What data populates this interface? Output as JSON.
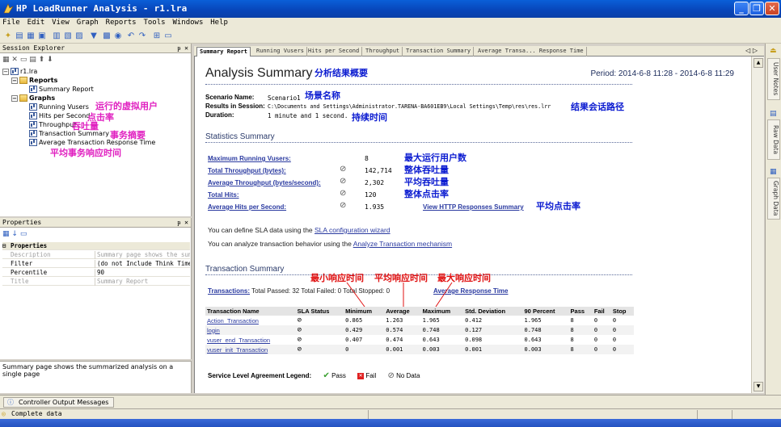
{
  "window": {
    "title": "HP LoadRunner Analysis - r1.lra"
  },
  "menu": [
    "File",
    "Edit",
    "View",
    "Graph",
    "Reports",
    "Tools",
    "Windows",
    "Help"
  ],
  "explorer": {
    "header": "Session Explorer",
    "root": "r1.lra",
    "reports": "Reports",
    "summary_report": "Summary Report",
    "graphs": "Graphs",
    "graph_items": [
      "Running Vusers",
      "Hits per Second",
      "Throughput",
      "Transaction Summary",
      "Average Transaction Response Time"
    ]
  },
  "annotations": {
    "running_vusers": "运行的虚拟用户",
    "hits_per_second": "点击率",
    "throughput": "吞吐量",
    "transaction_summary": "事务摘要",
    "avg_response": "平均事务响应时间",
    "analysis_summary": "分析结果概要",
    "scenario_name": "场景名称",
    "session_path": "结果会话路径",
    "duration": "持续时间",
    "max_running": "最大运行用户数",
    "total_throughput": "整体吞吐量",
    "avg_throughput": "平均吞吐量",
    "total_hits": "整体点击率",
    "avg_hits": "平均点击率",
    "min_resp": "最小响应时间",
    "avg_resp": "平均响应时间",
    "max_resp": "最大响应时间"
  },
  "properties": {
    "header": "Properties",
    "section": "Properties",
    "rows": [
      {
        "key": "Description",
        "value": "Summary page shows the summa"
      },
      {
        "key": "Filter",
        "value": "(do not Include Think Time)"
      },
      {
        "key": "Percentile",
        "value": "90"
      },
      {
        "key": "Title",
        "value": "Summary Report"
      }
    ],
    "description": "Summary page shows the summarized analysis on a single page"
  },
  "tabs": [
    "Summary Report",
    "Running Vusers",
    "Hits per Second",
    "Throughput",
    "Transaction Summary",
    "Average Transa... Response Time"
  ],
  "report": {
    "title": "Analysis Summary",
    "period": "Period: 2014-6-8 11:28 - 2014-6-8 11:29",
    "scenario_label": "Scenario Name:",
    "scenario_value": "Scenario1",
    "session_label": "Results in Session:",
    "session_value": "C:\\Documents and Settings\\Administrator.TARENA-BA601EB9\\Local Settings\\Temp\\res\\res.lrr",
    "duration_label": "Duration:",
    "duration_value": "1 minute and 1 second.",
    "stats_title": "Statistics Summary",
    "stats": [
      {
        "label": "Maximum Running Vusers:",
        "value": "8",
        "icon": false
      },
      {
        "label": "Total Throughput (bytes):",
        "value": "142,714",
        "icon": true
      },
      {
        "label": "Average Throughput (bytes/second):",
        "value": "2,302",
        "icon": true
      },
      {
        "label": "Total Hits:",
        "value": "120",
        "icon": true
      },
      {
        "label": "Average Hits per Second:",
        "value": "1.935",
        "icon": true
      }
    ],
    "http_link": "View HTTP Responses Summary",
    "sla_line_pre": "You can define SLA data using the ",
    "sla_link": "SLA configuration wizard",
    "analyze_line_pre": "You can analyze transaction behavior using the ",
    "analyze_link": "Analyze Transaction mechanism",
    "trans_title": "Transaction Summary",
    "trans_link": "Transactions:",
    "trans_counts": "Total Passed: 32 Total Failed: 0 Total Stopped: 0",
    "avg_resp_link": "Average Response Time",
    "columns": [
      "Transaction Name",
      "SLA Status",
      "Minimum",
      "Average",
      "Maximum",
      "Std. Deviation",
      "90 Percent",
      "Pass",
      "Fail",
      "Stop"
    ],
    "rows": [
      [
        "Action_Transaction",
        "",
        "0.865",
        "1.263",
        "1.965",
        "0.412",
        "1.965",
        "8",
        "0",
        "0"
      ],
      [
        "login",
        "",
        "0.429",
        "0.574",
        "0.748",
        "0.127",
        "0.748",
        "8",
        "0",
        "0"
      ],
      [
        "vuser_end_Transaction",
        "",
        "0.407",
        "0.474",
        "0.643",
        "0.098",
        "0.643",
        "8",
        "0",
        "0"
      ],
      [
        "vuser_init_Transaction",
        "",
        "0",
        "0.001",
        "0.003",
        "0.001",
        "0.003",
        "8",
        "0",
        "0"
      ]
    ],
    "legend_label": "Service Level Agreement Legend:",
    "legend_pass": "Pass",
    "legend_fail": "Fail",
    "legend_nodata": "No Data"
  },
  "right_tabs": [
    "User Notes",
    "Raw Data",
    "Graph Data"
  ],
  "output_tab": "Controller Output Messages",
  "status": "Complete data",
  "colors": {
    "annot_magenta": "#e020c0",
    "annot_blue": "#0a1ad0",
    "annot_red": "#e01010",
    "link": "#2a3aa0"
  }
}
